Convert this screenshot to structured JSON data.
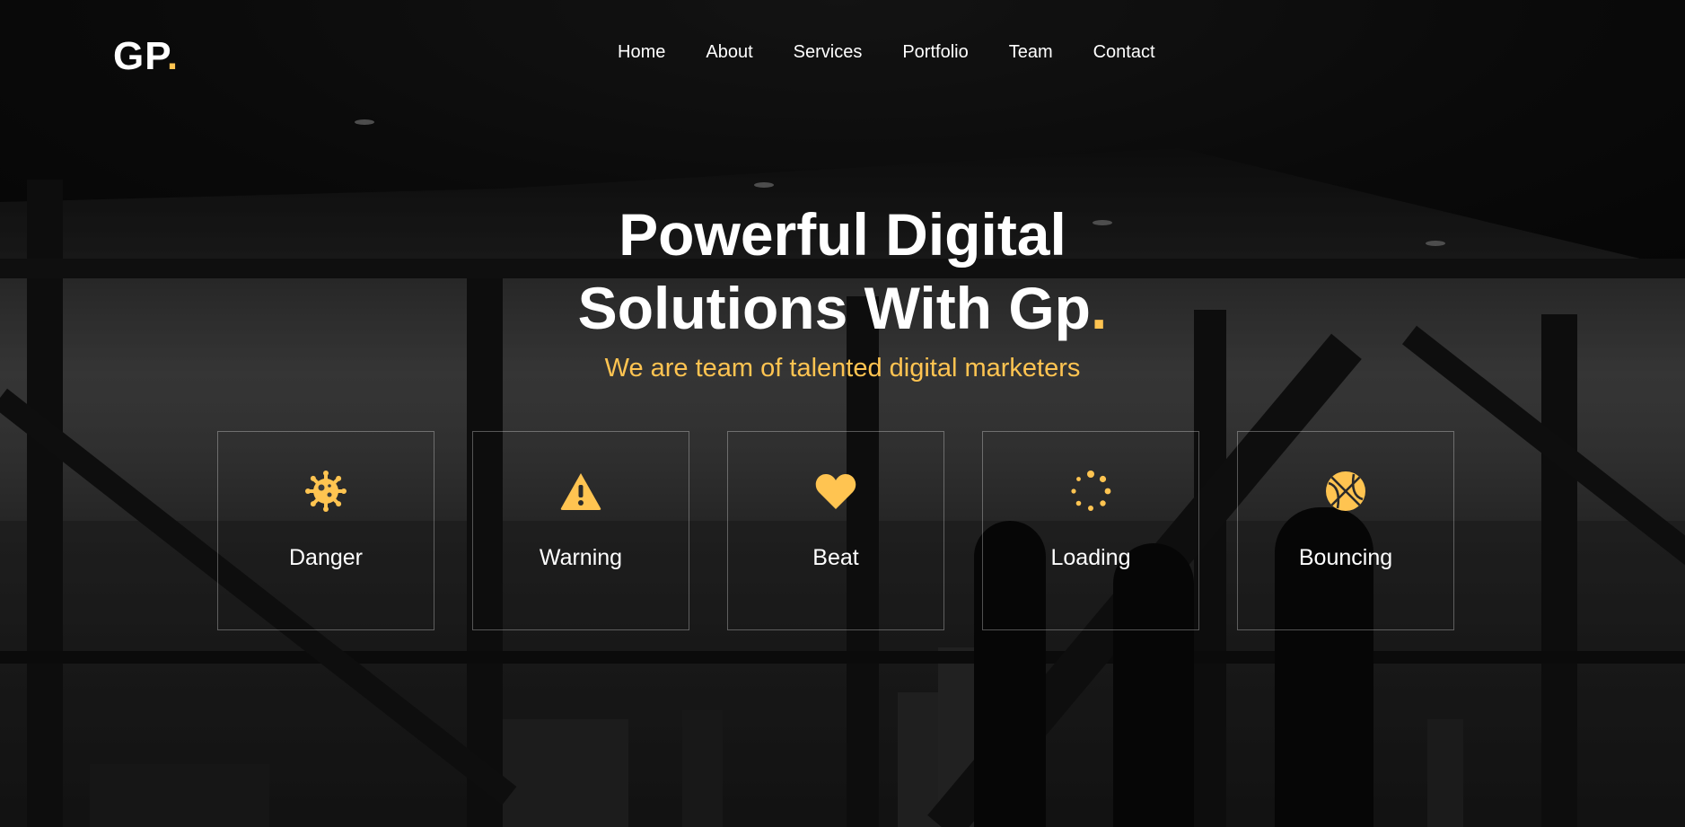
{
  "brand": {
    "name": "GP",
    "dot": "."
  },
  "nav": {
    "items": [
      "Home",
      "About",
      "Services",
      "Portfolio",
      "Team",
      "Contact"
    ]
  },
  "hero": {
    "title_line1": "Powerful Digital",
    "title_line2": "Solutions With Gp",
    "title_dot": ".",
    "subtitle": "We are team of talented digital marketers"
  },
  "features": [
    {
      "label": "Danger",
      "icon": "virus-icon"
    },
    {
      "label": "Warning",
      "icon": "warning-icon"
    },
    {
      "label": "Beat",
      "icon": "heart-icon"
    },
    {
      "label": "Loading",
      "icon": "spinner-icon"
    },
    {
      "label": "Bouncing",
      "icon": "basketball-icon"
    }
  ],
  "colors": {
    "accent": "#ffc451",
    "text": "#ffffff"
  }
}
